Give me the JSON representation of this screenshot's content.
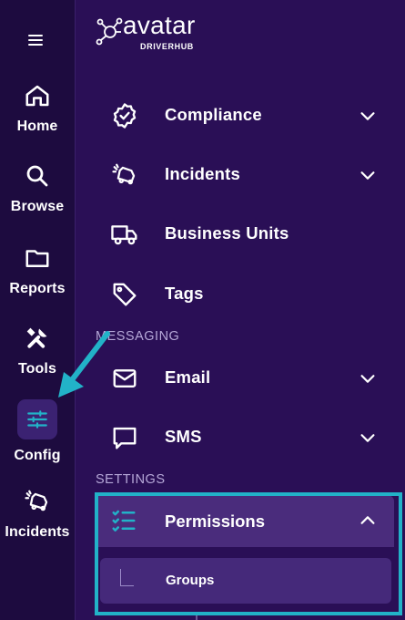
{
  "brand": {
    "name": "avatar",
    "subtitle": "DRIVERHUB"
  },
  "rail": {
    "items": [
      {
        "label": "Home",
        "icon": "home-icon"
      },
      {
        "label": "Browse",
        "icon": "search-icon"
      },
      {
        "label": "Reports",
        "icon": "folder-icon"
      },
      {
        "label": "Tools",
        "icon": "tools-icon"
      },
      {
        "label": "Config",
        "icon": "sliders-icon",
        "active": true
      },
      {
        "label": "Incidents",
        "icon": "car-crash-icon"
      }
    ]
  },
  "menu": {
    "compliance": "Compliance",
    "incidents": "Incidents",
    "business_units": "Business Units",
    "tags": "Tags",
    "messaging_header": "MESSAGING",
    "email": "Email",
    "sms": "SMS",
    "settings_header": "SETTINGS",
    "permissions": "Permissions",
    "groups": "Groups"
  },
  "colors": {
    "rail_bg": "#1d0b3f",
    "main_bg": "#2a0f56",
    "active_bg": "#4a2c7c",
    "accent": "#22b2c8"
  }
}
